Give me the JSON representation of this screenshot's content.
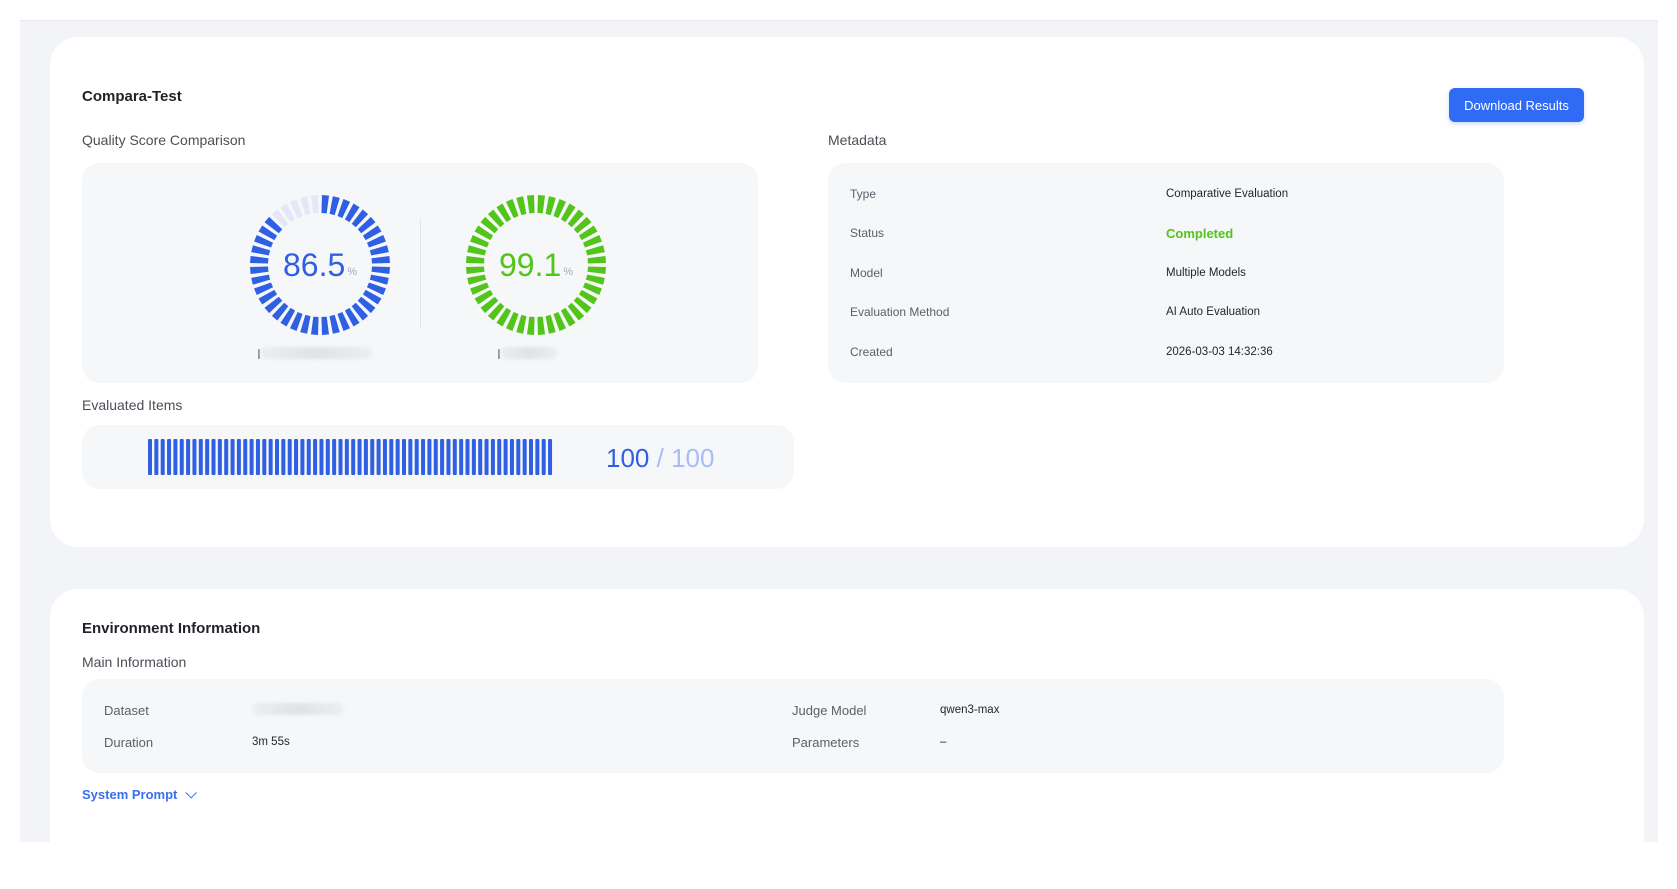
{
  "header": {
    "title": "Compara-Test",
    "download_label": "Download Results"
  },
  "quality": {
    "label": "Quality Score Comparison",
    "gauges": [
      {
        "value": "86.5",
        "unit": "%",
        "fraction": 0.865,
        "color": "#2f5fe3",
        "track": "#e3e8f8"
      },
      {
        "value": "99.1",
        "unit": "%",
        "fraction": 0.991,
        "color": "#52c41a",
        "track": "#e6f5dd"
      }
    ]
  },
  "metadata": {
    "label": "Metadata",
    "rows": [
      {
        "key": "Type",
        "value": "Comparative Evaluation"
      },
      {
        "key": "Status",
        "value": "Completed"
      },
      {
        "key": "Model",
        "value": "Multiple Models"
      },
      {
        "key": "Evaluation Method",
        "value": "AI Auto Evaluation"
      },
      {
        "key": "Created",
        "value": "2026-03-03 14:32:36"
      }
    ],
    "status_color": "#52c41a"
  },
  "evaluated": {
    "label": "Evaluated Items",
    "done": "100",
    "separator": "/",
    "total": "100",
    "fraction": 1.0,
    "bar_color": "#2f5fe3"
  },
  "environment": {
    "title": "Environment Information",
    "main_label": "Main Information",
    "dataset_key": "Dataset",
    "duration_key": "Duration",
    "duration_value": "3m 55s",
    "judge_key": "Judge Model",
    "judge_value": "qwen3-max",
    "params_key": "Parameters",
    "params_value": "–",
    "system_prompt_label": "System Prompt"
  }
}
